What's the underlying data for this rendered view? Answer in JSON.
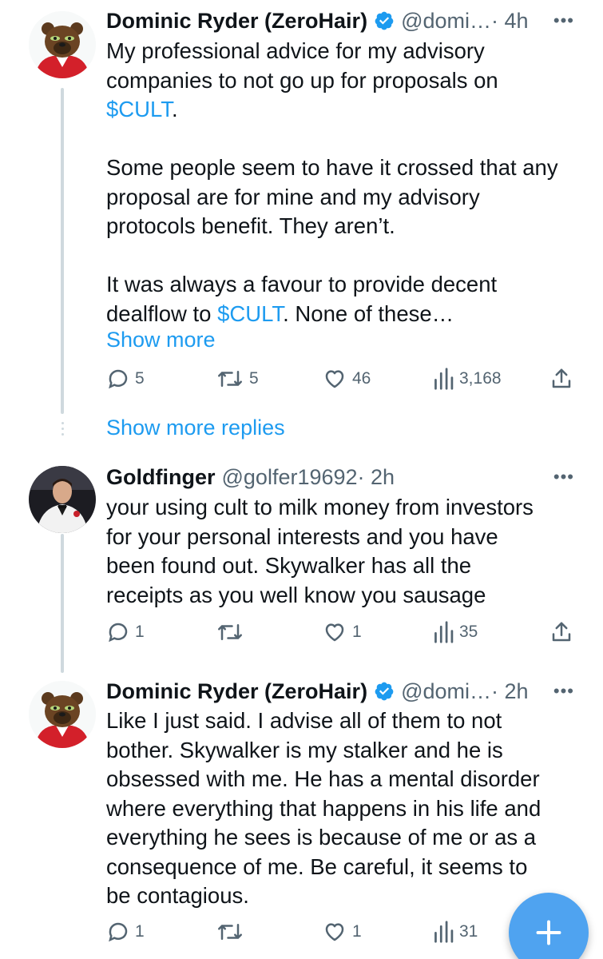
{
  "colors": {
    "accent": "#1d9bf0",
    "secondary_text": "#536471",
    "thread_line": "#cfd9de",
    "fab": "#4fa3f0"
  },
  "tweets": [
    {
      "display_name": "Dominic Ryder (ZeroHair)",
      "verified": true,
      "handle": "@domi…",
      "time": "· 4h",
      "avatar_icon": "bear-avatar-icon",
      "text_lines": [
        "My professional advice for my advisory",
        "companies to not go up for proposals on"
      ],
      "cashtag_1": "$CULT",
      "after_cashtag_1": ".",
      "para2_lines": [
        "Some people seem to have it crossed that any",
        "proposal are for mine and my advisory",
        "protocols benefit. They aren’t."
      ],
      "para3_line1": "It was always a favour to provide decent",
      "para3_before_cashtag": "dealflow to ",
      "cashtag_2": "$CULT",
      "para3_after_cashtag": ". None of these…",
      "show_more": "Show more",
      "replies": "5",
      "retweets": "5",
      "likes": "46",
      "views": "3,168"
    },
    {
      "display_name": "Goldfinger",
      "verified": false,
      "handle": "@golfer19692",
      "time": "· 2h",
      "avatar_icon": "tuxedo-man-avatar-icon",
      "text_lines": [
        "your using cult to milk money from investors",
        "for your personal interests and you have",
        "been found out. Skywalker has all the",
        "receipts as you well know you sausage"
      ],
      "replies": "1",
      "retweets": "",
      "likes": "1",
      "views": "35"
    },
    {
      "display_name": "Dominic Ryder (ZeroHair)",
      "verified": true,
      "handle": "@domi…",
      "time": "· 2h",
      "avatar_icon": "bear-avatar-icon",
      "text_lines": [
        "Like I just said. I advise all of them to not",
        "bother. Skywalker is my stalker and he is",
        "obsessed with me. He has a mental disorder",
        "where everything that happens in his life and",
        "everything he sees is because of me or as a",
        "consequence of me. Be careful, it seems to",
        "be contagious."
      ],
      "replies": "1",
      "retweets": "",
      "likes": "1",
      "views": "31"
    }
  ],
  "show_more_replies": "Show more replies",
  "icons": {
    "more": "more-horizontal-icon",
    "reply": "reply-bubble-icon",
    "retweet": "retweet-icon",
    "like": "heart-icon",
    "views": "views-bars-icon",
    "share": "share-icon",
    "compose": "plus-icon"
  }
}
